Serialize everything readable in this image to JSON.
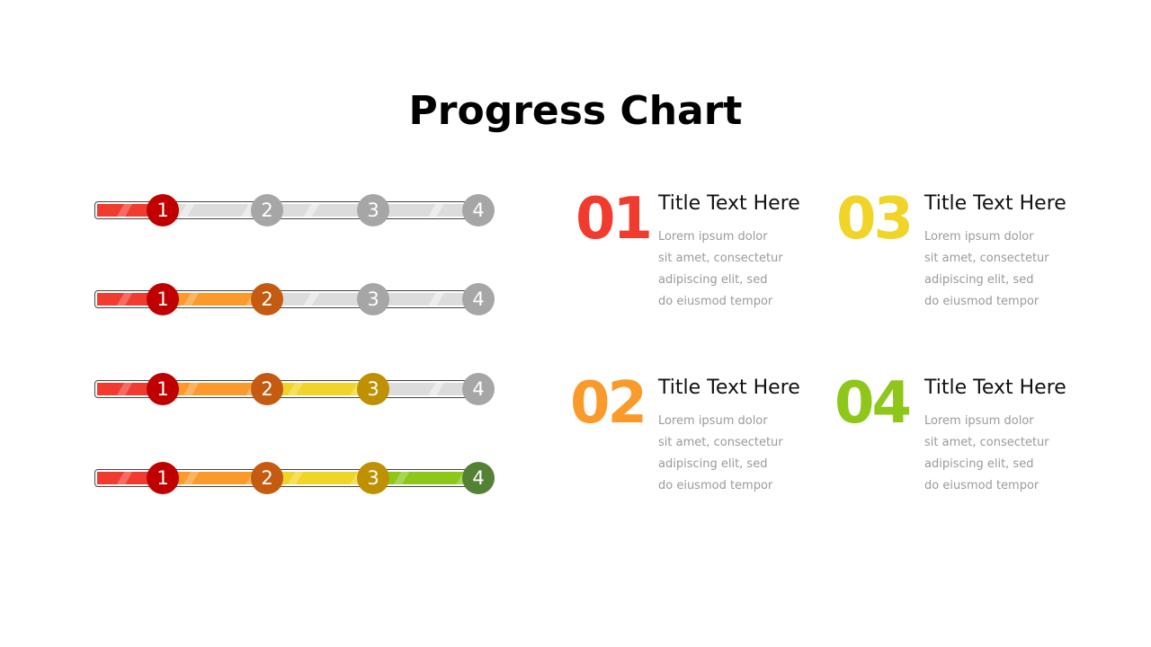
{
  "title": "Progress Chart",
  "colors": {
    "red": "#f23b2f",
    "orange": "#f99a2a",
    "yellow": "#f0d428",
    "green": "#8ec61a",
    "track": "#dcdcdc",
    "dot_inactive": "#a6a6a6",
    "dot_red": "#c00000",
    "dot_orange": "#c55a11",
    "dot_yellow": "#bf9000",
    "dot_green": "#548235"
  },
  "bars": [
    {
      "progress_stage": 1,
      "markers": [
        "1",
        "2",
        "3",
        "4"
      ]
    },
    {
      "progress_stage": 2,
      "markers": [
        "1",
        "2",
        "3",
        "4"
      ]
    },
    {
      "progress_stage": 3,
      "markers": [
        "1",
        "2",
        "3",
        "4"
      ]
    },
    {
      "progress_stage": 4,
      "markers": [
        "1",
        "2",
        "3",
        "4"
      ]
    }
  ],
  "cards": [
    {
      "number": "01",
      "title": "Title Text Here",
      "lines": [
        "Lorem ipsum dolor",
        "sit amet, consectetur",
        "adipiscing elit, sed",
        "do eiusmod tempor"
      ]
    },
    {
      "number": "02",
      "title": "Title Text Here",
      "lines": [
        "Lorem ipsum dolor",
        "sit amet, consectetur",
        "adipiscing elit, sed",
        "do eiusmod tempor"
      ]
    },
    {
      "number": "03",
      "title": "Title Text Here",
      "lines": [
        "Lorem ipsum dolor",
        "sit amet, consectetur",
        "adipiscing elit, sed",
        "do eiusmod tempor"
      ]
    },
    {
      "number": "04",
      "title": "Title Text Here",
      "lines": [
        "Lorem ipsum dolor",
        "sit amet, consectetur",
        "adipiscing elit, sed",
        "do eiusmod tempor"
      ]
    }
  ]
}
